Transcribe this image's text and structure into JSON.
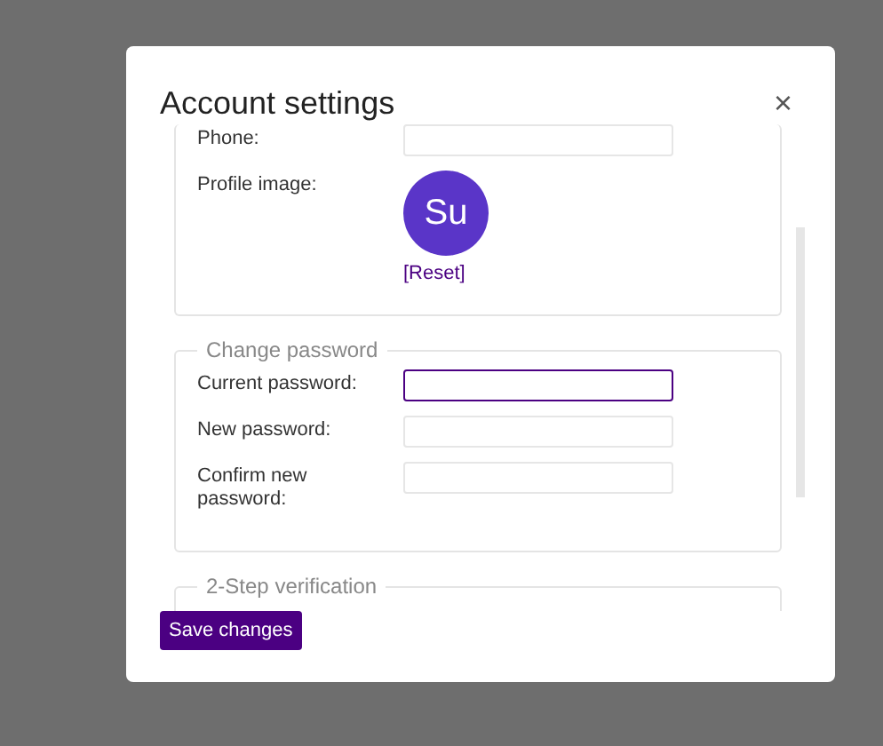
{
  "dialog": {
    "title": "Account settings",
    "close": "×"
  },
  "profile": {
    "fields": [
      {
        "label": "Phone:",
        "focused": false
      }
    ],
    "image_label": "Profile image:",
    "avatar": "Su",
    "reset": "[Reset]"
  },
  "password": {
    "legend": "Change password",
    "fields": [
      {
        "label": "Current password:",
        "focused": true
      },
      {
        "label": "New password:",
        "focused": false
      },
      {
        "label": "Confirm new password:",
        "focused": false
      }
    ]
  },
  "two_step": {
    "legend": "2-Step verification"
  },
  "save_button": "Save changes"
}
